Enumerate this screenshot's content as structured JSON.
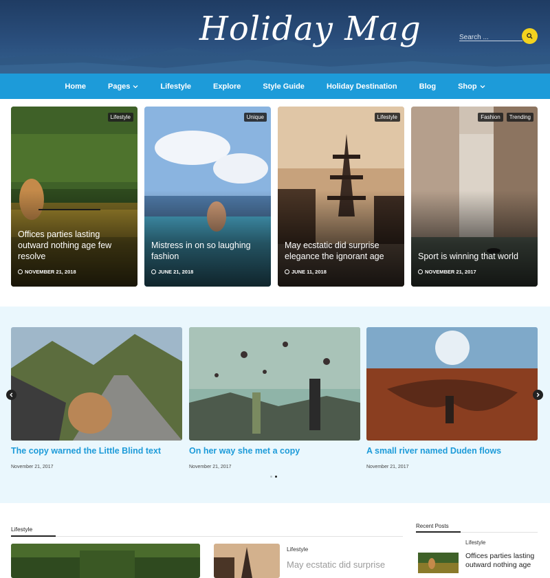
{
  "site": {
    "logo": "Holiday Mag",
    "search_placeholder": "Search ..."
  },
  "nav": {
    "items": [
      {
        "label": "Home",
        "dropdown": false
      },
      {
        "label": "Pages",
        "dropdown": true
      },
      {
        "label": "Lifestyle",
        "dropdown": false
      },
      {
        "label": "Explore",
        "dropdown": false
      },
      {
        "label": "Style Guide",
        "dropdown": false
      },
      {
        "label": "Holiday Destination",
        "dropdown": false
      },
      {
        "label": "Blog",
        "dropdown": false
      },
      {
        "label": "Shop",
        "dropdown": true
      }
    ]
  },
  "featured": [
    {
      "tags": [
        "Lifestyle"
      ],
      "title": "Offices parties lasting outward nothing age few resolve",
      "date": "NOVEMBER 21, 2018"
    },
    {
      "tags": [
        "Unique"
      ],
      "title": "Mistress in on so laughing fashion",
      "date": "JUNE 21, 2018"
    },
    {
      "tags": [
        "Lifestyle"
      ],
      "title": "May ecstatic did surprise elegance the ignorant age",
      "date": "JUNE 11, 2018"
    },
    {
      "tags": [
        "Fashion",
        "Trending"
      ],
      "title": "Sport is winning that world",
      "date": "NOVEMBER 21, 2017"
    }
  ],
  "slider": {
    "slides": [
      {
        "title": "The copy warned the Little Blind text",
        "date": "November 21, 2017"
      },
      {
        "title": "On her way she met a copy",
        "date": "November 21, 2017"
      },
      {
        "title": "A small river named Duden flows",
        "date": "November 21, 2017"
      }
    ],
    "active_dot": 2
  },
  "lifestyle_section": {
    "heading": "Lifestyle",
    "small_post": {
      "category": "Lifestyle",
      "title": "May ecstatic did surprise"
    }
  },
  "sidebar": {
    "heading": "Recent Posts",
    "post": {
      "category": "Lifestyle",
      "title": "Offices parties lasting outward nothing age"
    }
  },
  "colors": {
    "accent": "#1d9bd9",
    "search_button": "#f2d21f",
    "slider_bg": "#eaf7fd",
    "header_bg": "#24446e"
  }
}
